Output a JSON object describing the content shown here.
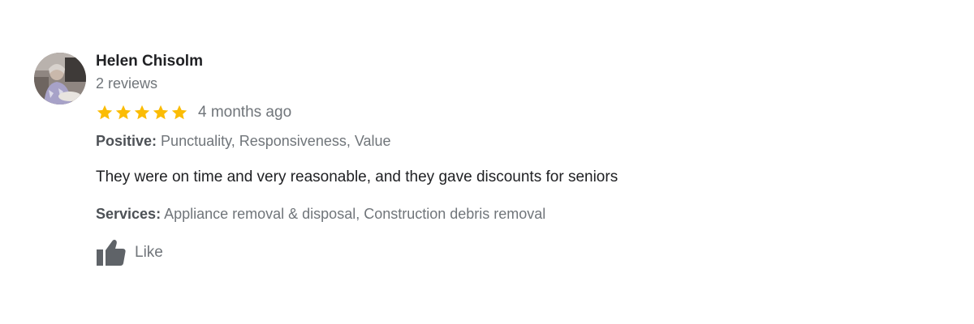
{
  "review": {
    "author": "Helen Chisolm",
    "reviews_count": "2 reviews",
    "rating": 5,
    "max_rating": 5,
    "time": "4 months ago",
    "positive_label": "Positive:",
    "positive_value": "Punctuality, Responsiveness, Value",
    "text": "They were on time and very reasonable, and they gave discounts for seniors",
    "services_label": "Services:",
    "services_value": "Appliance removal & disposal, Construction debris removal",
    "like_label": "Like"
  },
  "colors": {
    "star": "#fbbc04",
    "muted_text": "#70757a",
    "primary_text": "#202124"
  },
  "icons": {
    "avatar": "user-photo",
    "star": "star-icon",
    "like": "thumbs-up-icon"
  }
}
